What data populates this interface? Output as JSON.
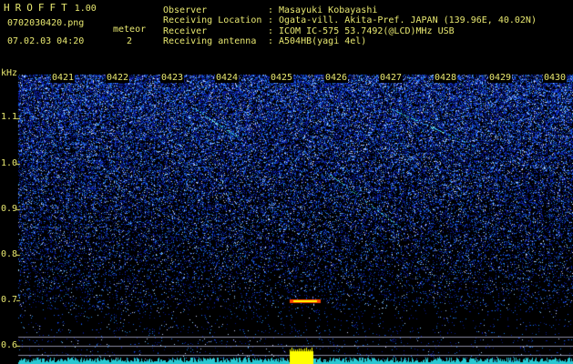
{
  "app": {
    "name": "HROFFT",
    "version": "1.00"
  },
  "header": {
    "filename": "0702030420.png",
    "datetime": "07.02.03 04:20",
    "meteor_label": "meteor",
    "meteor_count": "2",
    "fields": [
      {
        "label": "Observer",
        "value": "Masayuki Kobayashi"
      },
      {
        "label": "Receiving Location",
        "value": "Ogata-vill. Akita-Pref. JAPAN (139.96E, 40.02N)"
      },
      {
        "label": "Receiver",
        "value": "ICOM IC-575 53.7492(@LCD)MHz USB"
      },
      {
        "label": "Receiving antenna",
        "value": "A504HB(yagi 4el)"
      }
    ],
    "separator": ":"
  },
  "spectrogram": {
    "y_unit": "kHz",
    "y_ticks": [
      "1.1",
      "1.0",
      "0.9",
      "0.8",
      "0.7",
      "0.6"
    ],
    "time_ticks": [
      "0421",
      "0422",
      "0423",
      "0424",
      "0425",
      "0426",
      "0427",
      "0428",
      "0429",
      "0430"
    ],
    "colors": {
      "background": "#000000",
      "text": "#e8e870",
      "noise_low": "#0a1a8a",
      "noise_mid": "#2a5cff",
      "noise_high": "#9fe0ff",
      "meteor_core": "#ffff00",
      "meteor_edge": "#ff4000",
      "trace": "#33e0e0",
      "guide_line": "#8a8aa0"
    }
  }
}
